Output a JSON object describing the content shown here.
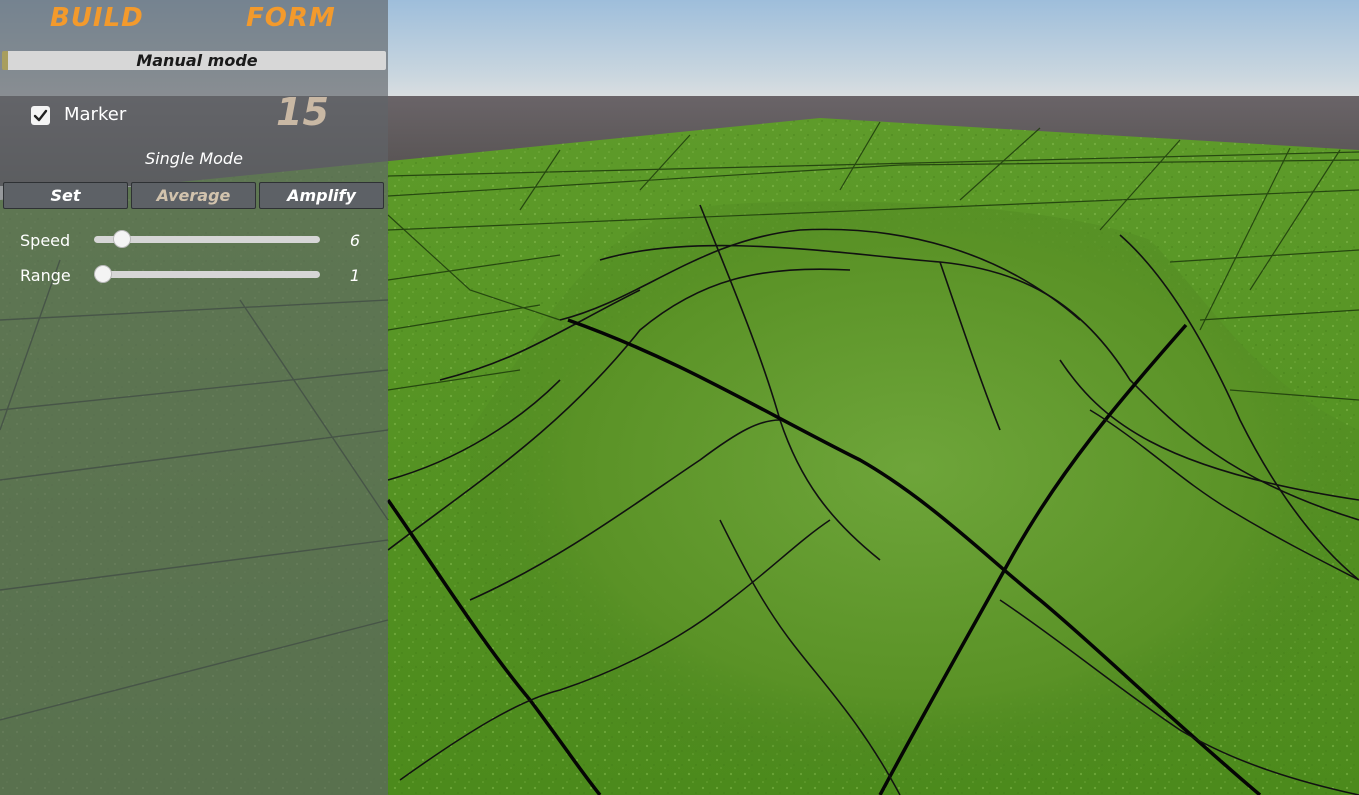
{
  "tabs": {
    "build": "BUILD",
    "form": "FORM"
  },
  "mode_bar": {
    "label": "Manual mode"
  },
  "marker": {
    "label": "Marker",
    "checked": true,
    "count": "15"
  },
  "single_mode_label": "Single Mode",
  "operations": {
    "set": "Set",
    "average": "Average",
    "amplify": "Amplify",
    "selected": "average"
  },
  "sliders": {
    "speed": {
      "label": "Speed",
      "value": "6",
      "fraction": 0.09
    },
    "range": {
      "label": "Range",
      "value": "1",
      "fraction": 0.0
    }
  },
  "colors": {
    "tab_text": "#f39a2c",
    "selected_button_text": "#d2c3ad",
    "counter": "#c9b8a4"
  }
}
